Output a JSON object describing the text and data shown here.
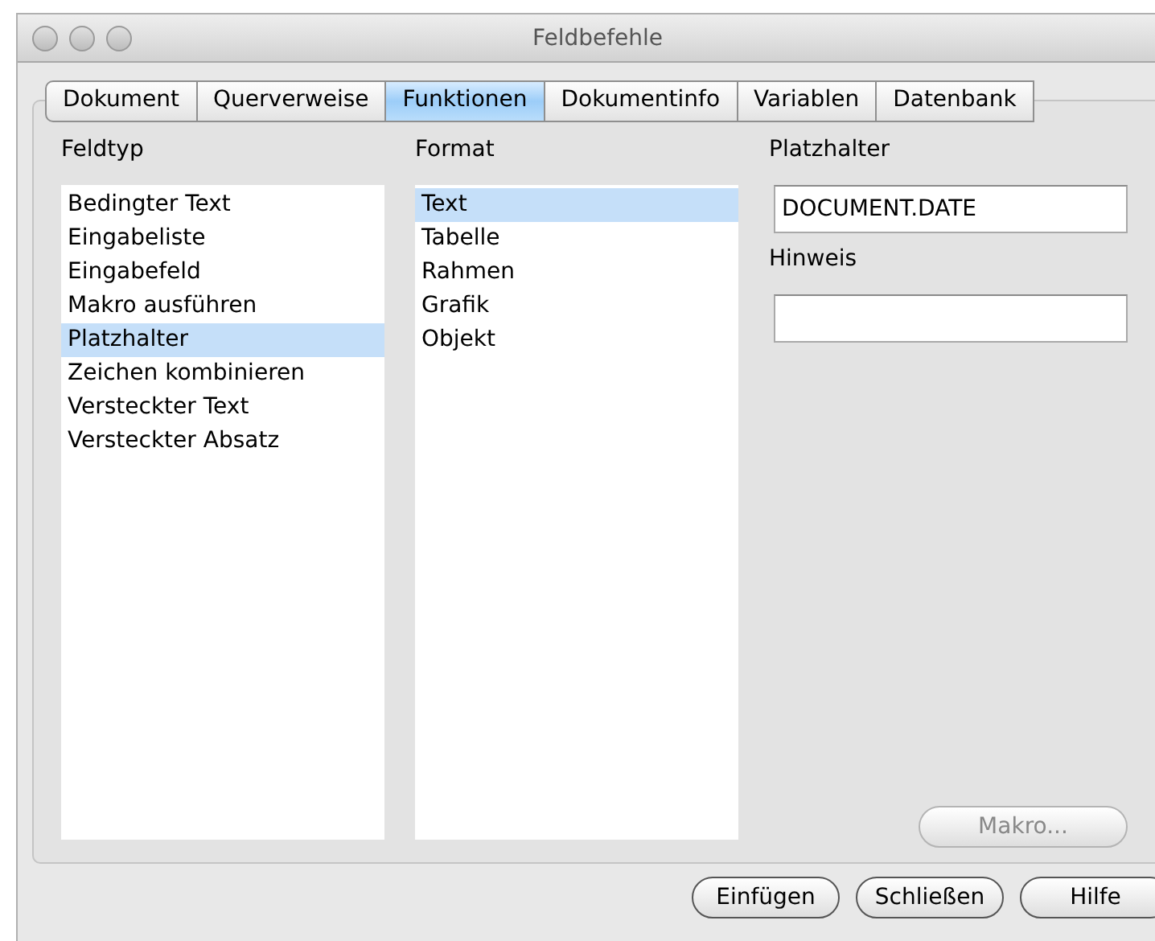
{
  "window": {
    "title": "Feldbefehle"
  },
  "tabs": [
    {
      "label": "Dokument",
      "selected": false
    },
    {
      "label": "Querverweise",
      "selected": false
    },
    {
      "label": "Funktionen",
      "selected": true
    },
    {
      "label": "Dokumentinfo",
      "selected": false
    },
    {
      "label": "Variablen",
      "selected": false
    },
    {
      "label": "Datenbank",
      "selected": false
    }
  ],
  "field_type": {
    "label": "Feldtyp",
    "items": [
      {
        "label": "Bedingter Text",
        "selected": false
      },
      {
        "label": "Eingabeliste",
        "selected": false
      },
      {
        "label": "Eingabefeld",
        "selected": false
      },
      {
        "label": "Makro ausführen",
        "selected": false
      },
      {
        "label": "Platzhalter",
        "selected": true
      },
      {
        "label": "Zeichen kombinieren",
        "selected": false
      },
      {
        "label": "Versteckter Text",
        "selected": false
      },
      {
        "label": "Versteckter Absatz",
        "selected": false
      }
    ]
  },
  "format": {
    "label": "Format",
    "items": [
      {
        "label": "Text",
        "selected": true
      },
      {
        "label": "Tabelle",
        "selected": false
      },
      {
        "label": "Rahmen",
        "selected": false
      },
      {
        "label": "Grafik",
        "selected": false
      },
      {
        "label": "Objekt",
        "selected": false
      }
    ]
  },
  "placeholder_field": {
    "label": "Platzhalter",
    "value": "DOCUMENT.DATE"
  },
  "hint_field": {
    "label": "Hinweis"
  },
  "macro_button": {
    "label": "Makro...",
    "disabled": true
  },
  "buttons": [
    "Einfügen",
    "Schließen",
    "Hilfe"
  ]
}
